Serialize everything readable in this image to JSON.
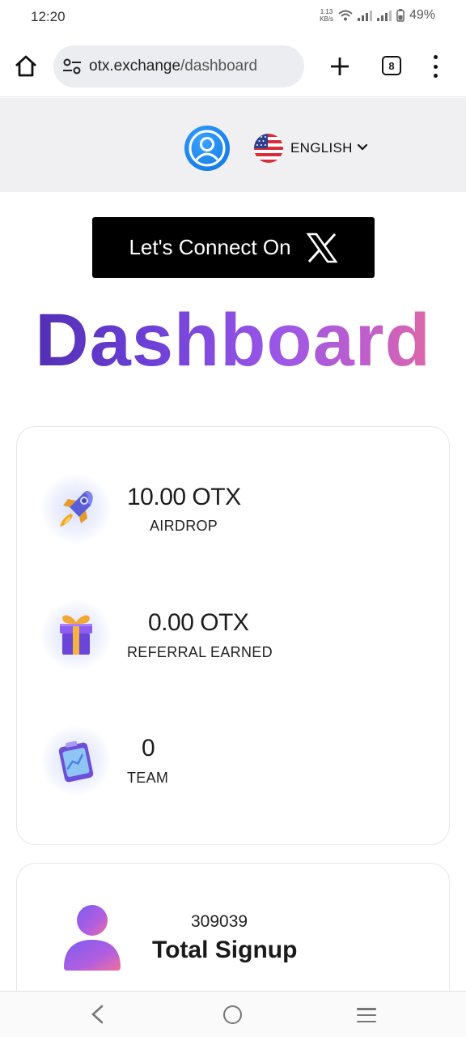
{
  "status_bar": {
    "time": "12:20",
    "net_speed_value": "1.13",
    "net_speed_unit": "KB/s",
    "battery": "49%",
    "icons": [
      "wifi-icon",
      "signal-icon",
      "signal-icon",
      "battery-icon"
    ]
  },
  "browser": {
    "url_host": "otx.exchange",
    "url_path": "/dashboard",
    "tab_count": "8",
    "icons": [
      "home-icon",
      "site-settings-icon",
      "plus-icon",
      "tabs-icon",
      "more-vert-icon"
    ]
  },
  "header": {
    "language_label": "ENGLISH",
    "icons": [
      "user-avatar-icon",
      "us-flag-icon",
      "chevron-down-icon"
    ]
  },
  "connect": {
    "label": "Let's Connect On",
    "icon": "x-logo-icon"
  },
  "page_title": "Dashboard",
  "stats": [
    {
      "value": "10.00 OTX",
      "label": "AIRDROP",
      "icon": "rocket-icon"
    },
    {
      "value": "0.00 OTX",
      "label": "REFERRAL EARNED",
      "icon": "gift-icon"
    },
    {
      "value": "0",
      "label": "TEAM",
      "icon": "clipboard-chart-icon"
    }
  ],
  "signup": {
    "count": "309039",
    "label": "Total Signup",
    "icon": "user-icon"
  },
  "nav": {
    "icons": [
      "back-icon",
      "home-circle-icon",
      "menu-icon"
    ]
  },
  "colors": {
    "title_gradient": [
      "#4b2aa8",
      "#9b57e6",
      "#ef6b94"
    ],
    "avatar_blue": "#0b6fe0",
    "connect_bg": "#000000",
    "header_bg": "#f0f0f2"
  }
}
